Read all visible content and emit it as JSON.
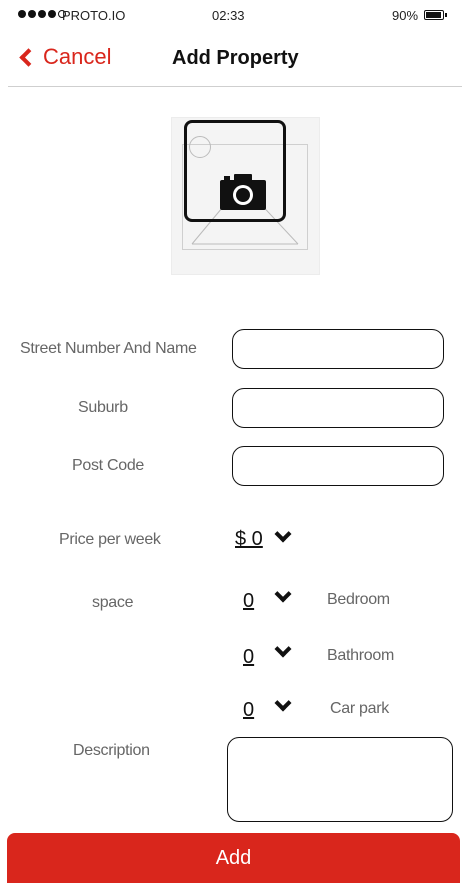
{
  "status_bar": {
    "carrier": "PROTO.IO",
    "time": "02:33",
    "battery": "90%"
  },
  "nav": {
    "cancel_label": "Cancel",
    "title": "Add Property"
  },
  "photo": {
    "icon": "camera-icon"
  },
  "form": {
    "street_label": "Street Number And Name",
    "suburb_label": "Suburb",
    "postcode_label": "Post Code",
    "price_label": "Price per week",
    "price_value": "$ 0",
    "space_label": "space",
    "bedroom_value": "0",
    "bedroom_label": "Bedroom",
    "bathroom_value": "0",
    "bathroom_label": "Bathroom",
    "carpark_value": "0",
    "carpark_label": "Car park",
    "description_label": "Description"
  },
  "add_button_label": "Add",
  "colors": {
    "accent": "#d9261c"
  }
}
